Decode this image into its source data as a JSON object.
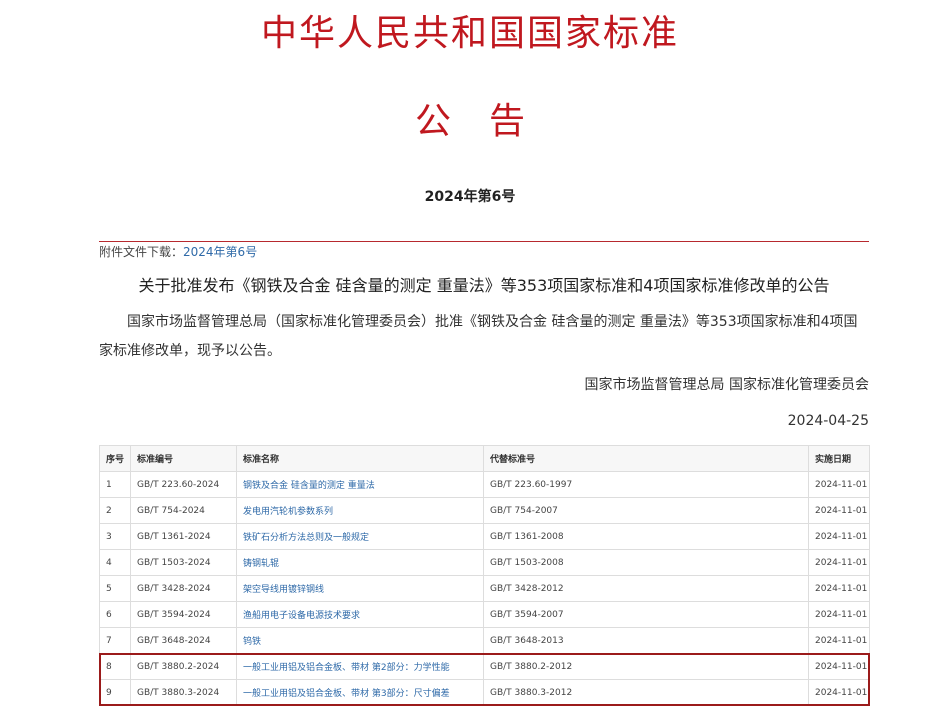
{
  "header": {
    "title": "中华人民共和国国家标准",
    "subtitle": "公告",
    "issue_no": "2024年第6号"
  },
  "attachment": {
    "label": "附件文件下载：",
    "link": "2024年第6号"
  },
  "notice": {
    "title": "关于批准发布《钢铁及合金 硅含量的测定 重量法》等353项国家标准和4项国家标准修改单的公告",
    "body": "国家市场监督管理总局（国家标准化管理委员会）批准《钢铁及合金 硅含量的测定 重量法》等353项国家标准和4项国家标准修改单，现予以公告。",
    "signer": "国家市场监督管理总局 国家标准化管理委员会",
    "date": "2024-04-25"
  },
  "table": {
    "headers": [
      "序号",
      "标准编号",
      "标准名称",
      "代替标准号",
      "实施日期"
    ],
    "rows": [
      [
        "1",
        "GB/T 223.60-2024",
        "钢铁及合金 硅含量的测定 重量法",
        "GB/T 223.60-1997",
        "2024-11-01"
      ],
      [
        "2",
        "GB/T 754-2024",
        "发电用汽轮机参数系列",
        "GB/T 754-2007",
        "2024-11-01"
      ],
      [
        "3",
        "GB/T 1361-2024",
        "铁矿石分析方法总则及一般规定",
        "GB/T 1361-2008",
        "2024-11-01"
      ],
      [
        "4",
        "GB/T 1503-2024",
        "铸钢轧辊",
        "GB/T 1503-2008",
        "2024-11-01"
      ],
      [
        "5",
        "GB/T 3428-2024",
        "架空导线用镀锌钢线",
        "GB/T 3428-2012",
        "2024-11-01"
      ],
      [
        "6",
        "GB/T 3594-2024",
        "渔船用电子设备电源技术要求",
        "GB/T 3594-2007",
        "2024-11-01"
      ],
      [
        "7",
        "GB/T 3648-2024",
        "钨铁",
        "GB/T 3648-2013",
        "2024-11-01"
      ],
      [
        "8",
        "GB/T 3880.2-2024",
        "一般工业用铝及铝合金板、带材 第2部分：力学性能",
        "GB/T 3880.2-2012",
        "2024-11-01"
      ],
      [
        "9",
        "GB/T 3880.3-2024",
        "一般工业用铝及铝合金板、带材 第3部分：尺寸偏差",
        "GB/T 3880.3-2012",
        "2024-11-01"
      ]
    ]
  },
  "colors": {
    "header_red": "#c0181f",
    "link_blue": "#2f6aa8",
    "highlight_border": "#9b1b1b"
  }
}
